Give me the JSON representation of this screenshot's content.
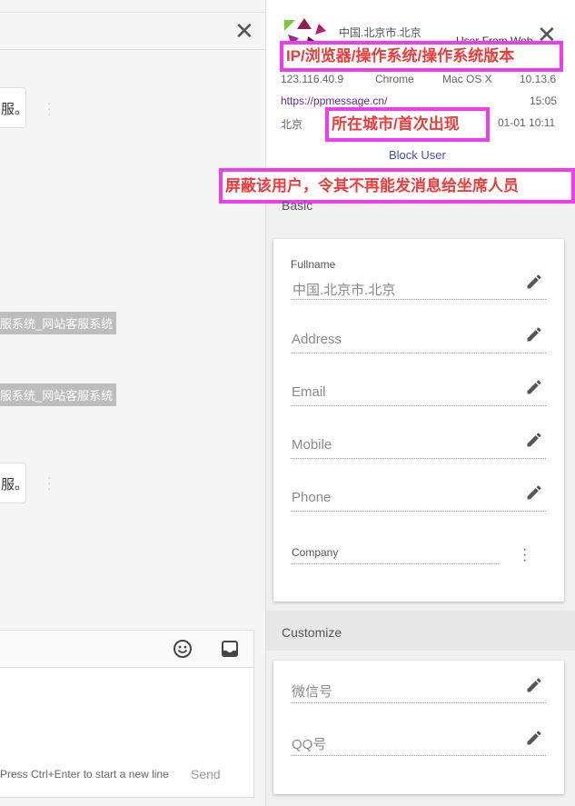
{
  "chat": {
    "close_icon": "close-icon",
    "messages": [
      {
        "text": "服。"
      },
      {
        "text": "服。"
      }
    ],
    "system_notes": [
      "服系统_网站客服系统",
      "服系统_网站客服系统"
    ],
    "composer": {
      "emoji_icon": "emoji-icon",
      "inbox_icon": "inbox-icon",
      "hint": "Press Ctrl+Enter to start a new line",
      "send_label": "Send"
    }
  },
  "profile": {
    "location": "中国.北京市.北京",
    "user_type": "User From Web",
    "close_icon": "close-icon",
    "ip": "123.116.40.9",
    "browser": "Chrome",
    "os": "Mac OS X",
    "os_version": "10.13.6",
    "url": "https://ppmessage.cn/",
    "time": "15:05",
    "city": "北京",
    "first_seen": "01-01 10:11",
    "block_user_label": "Block User",
    "annotations": {
      "ip_browser_os": "IP/浏览器/操作系统/操作系统版本",
      "city_first_seen": "所在城市/首次出现",
      "block_user": "屏蔽该用户，令其不再能发消息给坐席人员"
    },
    "basic_title": "Basic",
    "basic_fields": [
      {
        "label": "Fullname",
        "value": "中国.北京市.北京"
      },
      {
        "label": "",
        "value": "Address"
      },
      {
        "label": "",
        "value": "Email"
      },
      {
        "label": "",
        "value": "Mobile"
      },
      {
        "label": "",
        "value": "Phone"
      },
      {
        "label": "Company",
        "value": ""
      }
    ],
    "customize_title": "Customize",
    "customize_fields": [
      {
        "value": "微信号"
      },
      {
        "value": "QQ号"
      }
    ]
  },
  "colors": {
    "highlight_border": "#f03cf0",
    "annotation_text": "#ee3b3b",
    "link": "#5b2ca0",
    "block_user": "#3f51b5"
  }
}
